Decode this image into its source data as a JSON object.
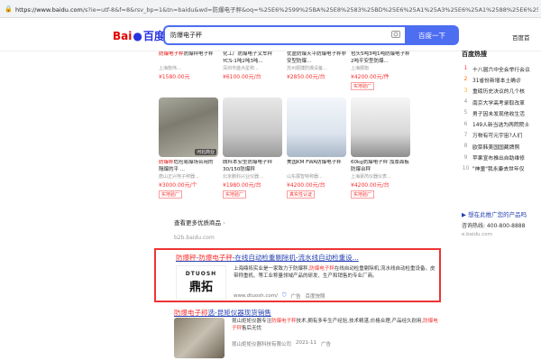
{
  "browser": {
    "url_host": "https://www.baidu.com",
    "url_rest": "/s?ie=utf-8&f=8&rsv_bp=1&tn=baidu&wd=防爆电子秤&oq=%25E6%2599%25BA%25E8%2583%25BD%25E6%25A1%25A3%25E6%25A1%2588%25E6%259F%259C&rsv_pq"
  },
  "header": {
    "logo_text_1": "Bai",
    "logo_text_2": "百度",
    "search_value": "防爆电子秤",
    "search_button": "百度一下",
    "user_link": "百度首"
  },
  "products": {
    "row1": [
      {
        "title_hl": "防爆电子秤",
        "title_rest": "防爆秤电子秤",
        "seller": "上海衡伟…",
        "price": "¥1580.00元"
      },
      {
        "title_hl": "",
        "title_rest": "化工厂防爆电子叉车秤YCS-1吨2吨3吨...",
        "seller": "深圳市盛点星称...",
        "price": "¥6100.00元/台"
      },
      {
        "title_hl": "",
        "title_rest": "优盈防爆天平防爆电子秤非安型防爆...",
        "seller": "苏州顺捷防爆设备...",
        "price": "¥2850.00元/台"
      },
      {
        "title_hl": "",
        "title_rest": "包头5吨3吨1吨防爆电子秤 2吨平安型防爆...",
        "seller": "上海顺衡",
        "price": "¥4200.00元/件",
        "badge": "实地验厂"
      }
    ],
    "row2": [
      {
        "title_hl": "防爆秤",
        "title_rest": "危险易爆场合用的隔爆的平 ...",
        "seller": "唐山正兴电子秤器...",
        "price": "¥3000.00元/个",
        "badge": "实地验厂",
        "img_tag": "河北商业"
      },
      {
        "title_hl": "",
        "title_rest": "朗科本安型防爆电子秤30/150防爆秤",
        "seller": "北京鹏科兴业仪器...",
        "price": "¥1980.00元/台",
        "badge": "实地验厂"
      },
      {
        "title_hl": "",
        "title_rest": "美国KM FWA防爆电子秤",
        "seller": "山东展智特称器...",
        "price": "¥4200.00元/台",
        "badge": "真实性认证"
      },
      {
        "title_hl": "",
        "title_rest": "60kg防爆电子秤 加厚面板防爆台秤",
        "seller": "上海豪芮仪器仪表...",
        "price": "¥4200.00元/台",
        "badge": "实地验厂"
      }
    ],
    "more_link": "查看更多优质商品",
    "source_url": "b2b.baidu.com"
  },
  "result1": {
    "title_hl_1": "防爆秤",
    "title_sep": "-",
    "title_hl_2": "防爆电子秤",
    "title_rest": "-在线自动检重剔除机-流水线自动检重设...",
    "logo_text": "DTUOSH",
    "logo_chars": "鼎拓",
    "desc_1": "上海鼎拓实业是一家致力于防爆秤,",
    "desc_hl": "防爆电子秤",
    "desc_2": "在线自动检重剔除机,流水线自动检重设备。皮带称重机、等工业称量领域产品的研发、生产和销售的专业厂商。",
    "url": "www.dtuosh.com/",
    "ad_label": "广告",
    "tag": "百度快照"
  },
  "result2": {
    "title_hl": "防爆电子称",
    "title_rest": "选-昆矩仪器现货销售",
    "desc_1": "昆山炬矩仪器专注",
    "desc_hl_1": "防爆电子秤",
    "desc_2": "技术,拥有多年生产经验,技术精湛,价格合理,产品经久耐用,",
    "desc_hl_2": "防爆电子秤",
    "desc_3": "售后无忧",
    "company": "昆山炬矩仪器科技有限公司",
    "date": "2021-11",
    "ad_label": "广告"
  },
  "hot": {
    "title": "百度热搜",
    "items": [
      {
        "n": "1",
        "text": "十八届六中全会举行会议"
      },
      {
        "n": "2",
        "text": "31省份新增本土确诊"
      },
      {
        "n": "3",
        "text": "重磅历史决议的几个核"
      },
      {
        "n": "4",
        "text": "南京大学高考录取改革"
      },
      {
        "n": "5",
        "text": "男子因未发现他收生活"
      },
      {
        "n": "6",
        "text": "149人新当选为两院院士"
      },
      {
        "n": "7",
        "text": "万物有可元宇宙?人们"
      },
      {
        "n": "8",
        "text": "欧菜韩美国国藏牌照"
      },
      {
        "n": "9",
        "text": "苹果宣布推出自助维修"
      },
      {
        "n": "10",
        "text": "\"神童\"我永康去世年仅"
      }
    ]
  },
  "ad": {
    "title": "▶ 想在此推广您的产品吗",
    "phone": "咨询热线: 400-800-8888",
    "url": "e.baidu.com"
  },
  "colors": {
    "brand_blue": "#4e6ef2",
    "link_blue": "#2440b3",
    "highlight_red": "#f73131",
    "box_red": "#e33"
  }
}
